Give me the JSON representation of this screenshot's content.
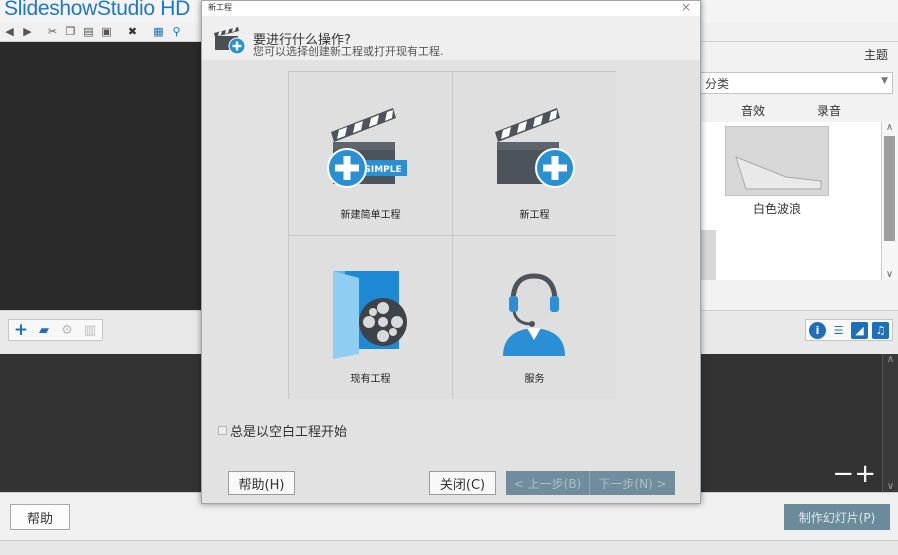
{
  "app": {
    "logo_prefix": "Slideshow",
    "logo_suffix": "Studio HD",
    "theme_link": "主题",
    "category_select": "分类",
    "tabs": [
      "音效",
      "录音"
    ],
    "thumbnail_label": "白色波浪",
    "help_button": "帮助",
    "make_slideshow_button": "制作幻灯片(P)",
    "zoom_minus": "−",
    "zoom_plus": "+"
  },
  "dialog": {
    "title": "新工程",
    "close_glyph": "×",
    "question": "要进行什么操作?",
    "subtitle": "您可以选择创建新工程或打开现有工程.",
    "tiles": [
      {
        "label": "新建简单工程",
        "badge": "SIMPLE"
      },
      {
        "label": "新工程"
      },
      {
        "label": "现有工程"
      },
      {
        "label": "服务"
      }
    ],
    "checkbox_label": "总是以空白工程开始",
    "help_button": "帮助(H)",
    "close_button": "关闭(C)",
    "prev_button": "< 上一步(B)",
    "next_button": "下一步(N) >"
  },
  "colors": {
    "accent": "#1e78c8",
    "icon_blue": "#2b8fd6",
    "nav_button": "#6f8d9c"
  }
}
